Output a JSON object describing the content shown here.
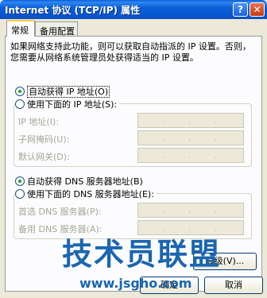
{
  "window": {
    "title": "Internet 协议 (TCP/IP) 属性",
    "help_glyph": "?",
    "close_glyph": "✕"
  },
  "tabs": [
    {
      "label": "常规"
    },
    {
      "label": "备用配置"
    }
  ],
  "intro": {
    "line1": "如果网络支持此功能，则可以获取自动指派的 IP 设置。否则，",
    "line2": "您需要从网络系统管理员处获得适当的 IP 设置。"
  },
  "ip_mode": {
    "auto_label": "自动获得 IP 地址(O)",
    "manual_label": "使用下面的 IP 地址(S):",
    "selected": "auto"
  },
  "ip_fields": [
    {
      "label": "IP 地址(I):"
    },
    {
      "label": "子网掩码(U):"
    },
    {
      "label": "默认网关(D):"
    }
  ],
  "dns_mode": {
    "auto_label": "自动获得 DNS 服务器地址(B)",
    "manual_label": "使用下面的 DNS 服务器地址(E):",
    "selected": "auto"
  },
  "dns_fields": [
    {
      "label": "首选 DNS 服务器(P):"
    },
    {
      "label": "备用 DNS 服务器(A):"
    }
  ],
  "buttons": {
    "advanced": "高级(V)...",
    "ok": "确定",
    "cancel": "取消"
  },
  "watermark": {
    "text": "技术员联盟",
    "url": "www.jsgho.com"
  }
}
